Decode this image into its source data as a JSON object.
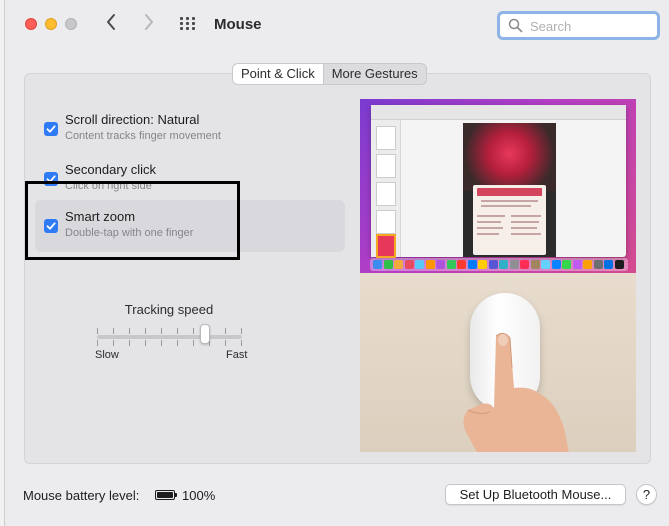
{
  "window": {
    "title": "Mouse",
    "nav_back_icon": "chevron-left-icon",
    "nav_forward_icon": "chevron-right-icon",
    "grid_icon": "show-all-grid-icon"
  },
  "search": {
    "placeholder": "Search",
    "value": ""
  },
  "tabs": [
    {
      "label": "Point & Click",
      "active": true
    },
    {
      "label": "More Gestures",
      "active": false
    }
  ],
  "options": [
    {
      "title": "Scroll direction: Natural",
      "subtitle": "Content tracks finger movement",
      "checked": true
    },
    {
      "title": "Secondary click",
      "subtitle": "Click on right side",
      "checked": true
    },
    {
      "title": "Smart zoom",
      "subtitle": "Double-tap with one finger",
      "checked": true,
      "selected": true
    }
  ],
  "tracking": {
    "label": "Tracking speed",
    "min_label": "Slow",
    "max_label": "Fast",
    "level_fraction": 0.75
  },
  "battery": {
    "label": "Mouse battery level:",
    "percent": "100%"
  },
  "buttons": {
    "bluetooth": "Set Up Bluetooth Mouse...",
    "help": "?"
  },
  "colors": {
    "accent": "#2f7bf6",
    "search_focus": "#8eb3e6"
  }
}
